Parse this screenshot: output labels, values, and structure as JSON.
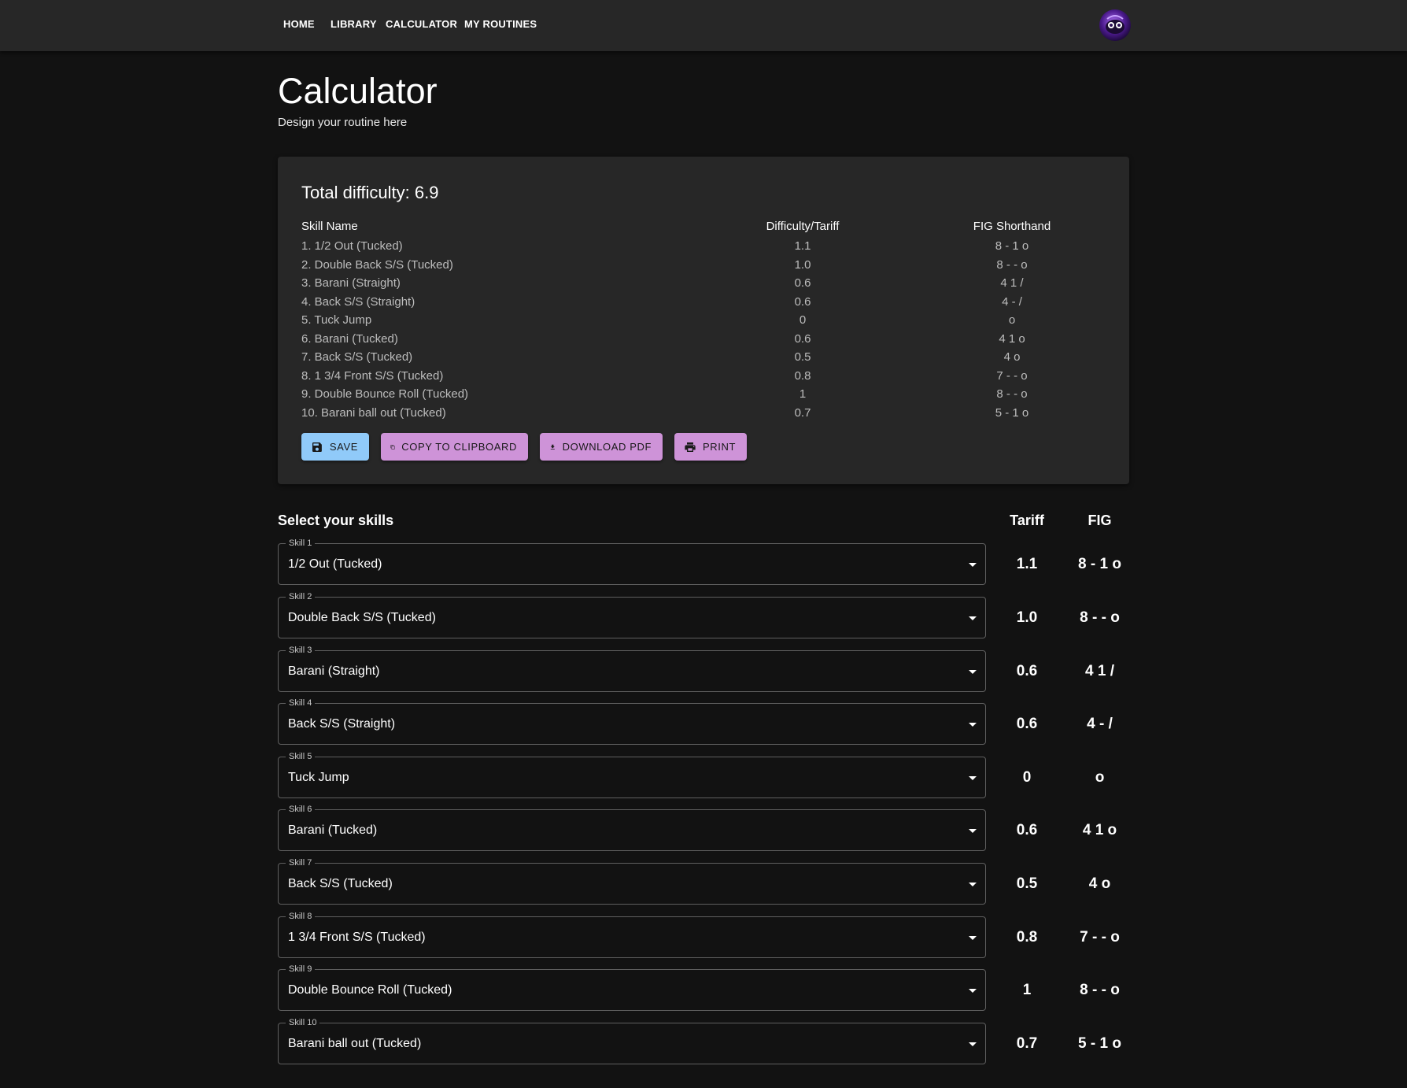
{
  "nav": {
    "links": [
      "HOME",
      "LIBRARY",
      "CALCULATOR",
      "MY ROUTINES"
    ]
  },
  "page": {
    "title": "Calculator",
    "subtitle": "Design your routine here"
  },
  "summary": {
    "total_label": "Total difficulty: 6.9",
    "headers": [
      "Skill Name",
      "Difficulty/Tariff",
      "FIG Shorthand"
    ],
    "rows": [
      {
        "name": "1. 1/2 Out (Tucked)",
        "diff": "1.1",
        "fig": "8 - 1 o"
      },
      {
        "name": "2. Double Back S/S (Tucked)",
        "diff": "1.0",
        "fig": "8 - - o"
      },
      {
        "name": "3. Barani (Straight)",
        "diff": "0.6",
        "fig": "4 1 /"
      },
      {
        "name": "4. Back S/S (Straight)",
        "diff": "0.6",
        "fig": "4 - /"
      },
      {
        "name": "5. Tuck Jump",
        "diff": "0",
        "fig": "o"
      },
      {
        "name": "6. Barani (Tucked)",
        "diff": "0.6",
        "fig": "4 1 o"
      },
      {
        "name": "7. Back S/S (Tucked)",
        "diff": "0.5",
        "fig": "4 o"
      },
      {
        "name": "8. 1 3/4 Front S/S (Tucked)",
        "diff": "0.8",
        "fig": "7 - - o"
      },
      {
        "name": "9. Double Bounce Roll (Tucked)",
        "diff": "1",
        "fig": "8 - - o"
      },
      {
        "name": "10. Barani ball out (Tucked)",
        "diff": "0.7",
        "fig": "5 - 1 o"
      }
    ],
    "buttons": {
      "save": "SAVE",
      "copy": "COPY TO CLIPBOARD",
      "pdf": "DOWNLOAD PDF",
      "print": "PRINT"
    }
  },
  "select": {
    "title": "Select your skills",
    "tariff_header": "Tariff",
    "fig_header": "FIG",
    "skills": [
      {
        "label": "Skill 1",
        "value": "1/2 Out (Tucked)",
        "tariff": "1.1",
        "fig": "8 - 1 o"
      },
      {
        "label": "Skill 2",
        "value": "Double Back S/S (Tucked)",
        "tariff": "1.0",
        "fig": "8 - - o"
      },
      {
        "label": "Skill 3",
        "value": "Barani (Straight)",
        "tariff": "0.6",
        "fig": "4 1 /"
      },
      {
        "label": "Skill 4",
        "value": "Back S/S (Straight)",
        "tariff": "0.6",
        "fig": "4 - /"
      },
      {
        "label": "Skill 5",
        "value": "Tuck Jump",
        "tariff": "0",
        "fig": "o"
      },
      {
        "label": "Skill 6",
        "value": "Barani (Tucked)",
        "tariff": "0.6",
        "fig": "4 1 o"
      },
      {
        "label": "Skill 7",
        "value": "Back S/S (Tucked)",
        "tariff": "0.5",
        "fig": "4 o"
      },
      {
        "label": "Skill 8",
        "value": "1 3/4 Front S/S (Tucked)",
        "tariff": "0.8",
        "fig": "7 - - o"
      },
      {
        "label": "Skill 9",
        "value": "Double Bounce Roll (Tucked)",
        "tariff": "1",
        "fig": "8 - - o"
      },
      {
        "label": "Skill 10",
        "value": "Barani ball out (Tucked)",
        "tariff": "0.7",
        "fig": "5 - 1 o"
      }
    ]
  },
  "colors": {
    "background": "#121212",
    "surface": "#272727",
    "primary": "#90caf9",
    "secondary": "#ce93d8"
  },
  "icons": [
    "avatar-icon",
    "save-icon",
    "copy-icon",
    "download-icon",
    "print-icon",
    "dropdown-arrow-icon"
  ]
}
